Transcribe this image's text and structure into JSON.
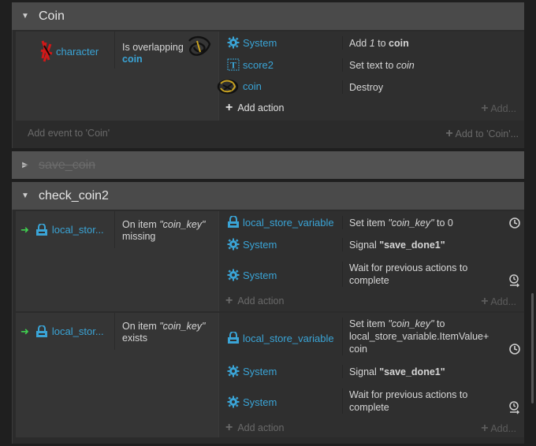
{
  "groups": {
    "coin": {
      "title": "Coin",
      "add_event": "Add event to 'Coin'",
      "add_to": "Add to 'Coin'..."
    },
    "save_coin": {
      "title": "save_coin"
    },
    "check_coin2": {
      "title": "check_coin2"
    }
  },
  "coin_event": {
    "cond_object": "character",
    "cond_text": "Is overlapping",
    "cond_target": "coin",
    "actions": [
      {
        "object": "System",
        "icon": "gear-icon",
        "pre": "Add ",
        "value": "1",
        "mid": " to ",
        "target": "coin"
      },
      {
        "object": "score2",
        "icon": "text-icon",
        "pre": "Set text to ",
        "value": "coin"
      },
      {
        "object": "coin",
        "icon": "sprite-icon",
        "text": "Destroy"
      }
    ],
    "add_action": "Add action",
    "add_right": "Add..."
  },
  "check_event1": {
    "cond_object": "local_stor...",
    "cond_pre": "On item ",
    "cond_key": "\"coin_key\"",
    "cond_post": "missing",
    "actions": [
      {
        "object": "local_store_variable",
        "pre": "Set item ",
        "key": "\"coin_key\"",
        "post": " to 0"
      },
      {
        "object": "System",
        "pre": "Signal ",
        "signal": "\"save_done1\""
      },
      {
        "object": "System",
        "text": "Wait for previous actions to complete"
      }
    ],
    "add_action": "Add action",
    "add_right": "Add..."
  },
  "check_event2": {
    "cond_object": "local_stor...",
    "cond_pre": "On item ",
    "cond_key": "\"coin_key\"",
    "cond_post": "exists",
    "actions": [
      {
        "object": "local_store_variable",
        "pre": "Set item ",
        "key": "\"coin_key\"",
        "post": " to local_store_variable.ItemValue+ coin"
      },
      {
        "object": "System",
        "pre": "Signal ",
        "signal": "\"save_done1\""
      },
      {
        "object": "System",
        "text": "Wait for previous actions to complete"
      }
    ],
    "add_action": "Add action",
    "add_right": "Add..."
  },
  "colors": {
    "link": "#3aa4d6",
    "arrow": "#3fcf4f",
    "header": "#4a4a4a"
  }
}
